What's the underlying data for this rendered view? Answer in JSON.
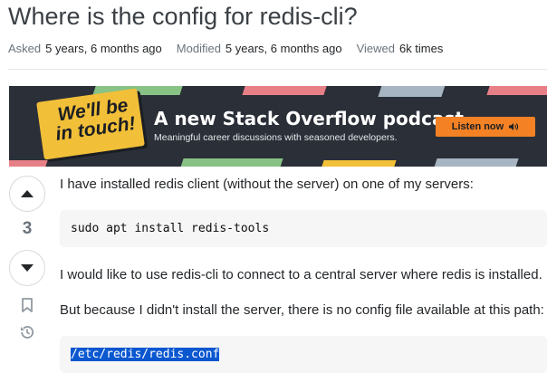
{
  "question": {
    "title": "Where is the config for redis-cli?",
    "meta": {
      "asked_label": "Asked",
      "asked_value": "5 years, 6 months ago",
      "modified_label": "Modified",
      "modified_value": "5 years, 6 months ago",
      "viewed_label": "Viewed",
      "viewed_value": "6k times"
    },
    "vote_count": "3"
  },
  "banner": {
    "logo_line1": "We'll be",
    "logo_line2": "in touch!",
    "headline": "A new Stack Overflow podcast.",
    "subline": "Meaningful career discussions with seasoned developers.",
    "button_label": "Listen now"
  },
  "post": {
    "para1": "I have installed redis client (without the server) on one of my servers:",
    "code1": "sudo apt install redis-tools",
    "para2": "I would like to use redis-cli to connect to a central server where redis is installed.",
    "para3": "But because I didn't install the server, there is no config file available at this path:",
    "code2": "/etc/redis/redis.conf"
  },
  "icons": {
    "upvote": "arrow-up-icon",
    "downvote": "arrow-down-icon",
    "bookmark": "bookmark-icon",
    "history": "history-icon",
    "speaker": "speaker-icon"
  },
  "colors": {
    "banner_bg": "#2a2f38",
    "badge_yellow": "#f2bf38",
    "button_orange": "#f48225",
    "selection_blue": "#0b57d0"
  }
}
